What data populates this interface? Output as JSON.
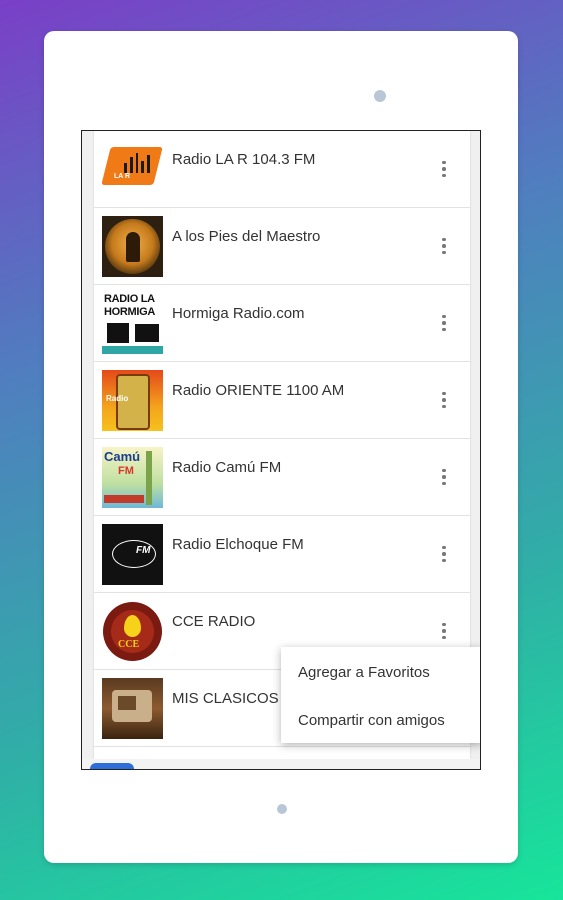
{
  "stations": [
    {
      "name": "Radio LA R 104.3 FM",
      "logo_text": "LA R"
    },
    {
      "name": "A los Pies del Maestro"
    },
    {
      "name": "Hormiga Radio.com",
      "logo_lines": [
        "RADIO LA",
        "HORMIGA"
      ]
    },
    {
      "name": "Radio ORIENTE 1100 AM",
      "logo_text": "Radio"
    },
    {
      "name": "Radio Camú FM",
      "logo_lines": [
        "Camú",
        "FM"
      ]
    },
    {
      "name": "Radio Elchoque FM",
      "logo_text": "FM"
    },
    {
      "name": "CCE RADIO",
      "logo_text": "CCE"
    },
    {
      "name": "MIS CLASICOS"
    }
  ],
  "context_menu": {
    "items": [
      "Agregar a Favoritos",
      "Compartir con amigos"
    ]
  },
  "icons": {
    "row_overflow": "more-vert-icon"
  }
}
